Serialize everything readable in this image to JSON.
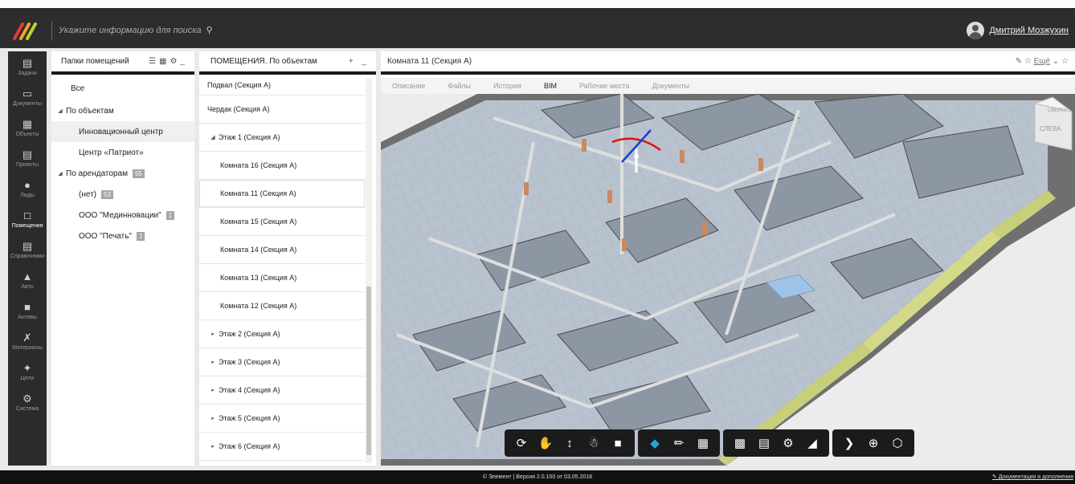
{
  "header": {
    "search_placeholder": "Укажите информацию для поиска",
    "user_name": "Дмитрий Мозжухин"
  },
  "sidebar": {
    "items": [
      {
        "label": "Задачи",
        "icon": "clipboard-icon"
      },
      {
        "label": "Документы",
        "icon": "folder-icon"
      },
      {
        "label": "Объекты",
        "icon": "building-icon"
      },
      {
        "label": "Проекты",
        "icon": "projects-icon"
      },
      {
        "label": "Лиды",
        "icon": "person-icon"
      },
      {
        "label": "Помещения",
        "icon": "room-icon",
        "active": true
      },
      {
        "label": "Справочники",
        "icon": "book-icon"
      },
      {
        "label": "Авто",
        "icon": "car-icon"
      },
      {
        "label": "Активы",
        "icon": "box-icon"
      },
      {
        "label": "Материалы",
        "icon": "tools-icon"
      },
      {
        "label": "Цели",
        "icon": "target-icon"
      },
      {
        "label": "Система",
        "icon": "gears-icon"
      }
    ]
  },
  "folders": {
    "title": "Папки помещений",
    "items": [
      {
        "label": "Все"
      },
      {
        "label": "По объектам"
      },
      {
        "label": "Инновационный центр"
      },
      {
        "label": "Центр «Патриот»"
      },
      {
        "label": "По арендаторам",
        "count": "55"
      },
      {
        "label": "(нет)",
        "count": "53"
      },
      {
        "label": "ООО \"Мединновации\"",
        "count": "1"
      },
      {
        "label": "ООО \"Печать\"",
        "count": "1"
      }
    ]
  },
  "rooms": {
    "title": "ПОМЕЩЕНИЯ. По объектам",
    "items": [
      {
        "label": "Подвал (Секция А)"
      },
      {
        "label": "Чердак (Секция А)"
      },
      {
        "label": "Этаж 1 (Секция А)"
      },
      {
        "label": "Комната 16 (Секция А)"
      },
      {
        "label": "Комната 11 (Секция А)"
      },
      {
        "label": "Комната 15 (Секция А)"
      },
      {
        "label": "Комната 14 (Секция А)"
      },
      {
        "label": "Комната 13 (Секция А)"
      },
      {
        "label": "Комната 12 (Секция А)"
      },
      {
        "label": "Этаж 2 (Секция А)"
      },
      {
        "label": "Этаж 3 (Секция А)"
      },
      {
        "label": "Этаж 4 (Секция А)"
      },
      {
        "label": "Этаж 5 (Секция А)"
      },
      {
        "label": "Этаж 6 (Секция А)"
      }
    ]
  },
  "detail": {
    "title": "Комната 11 (Секция А)",
    "more": "Ещё",
    "tabs": [
      "Описание",
      "Файлы",
      "История",
      "BIM",
      "Рабочие места",
      "Документы"
    ],
    "viewcube": {
      "top": "СВЕРХУ",
      "left": "СЛЕВА"
    }
  },
  "footer": {
    "copyright": "© Элемент | Версия 2.0.100 от 03.05.2018",
    "docs_link": "Документация и дополнения"
  }
}
